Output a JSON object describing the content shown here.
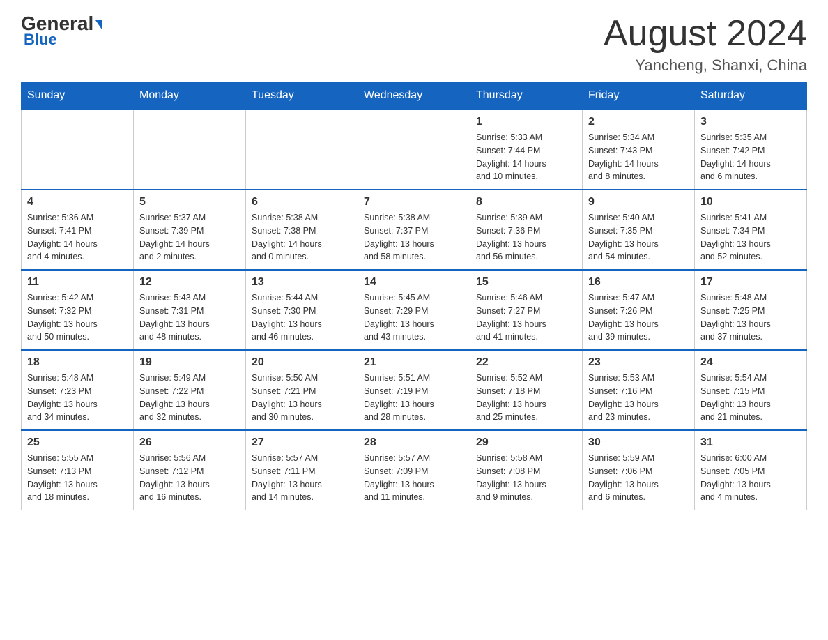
{
  "header": {
    "logo_general": "General",
    "logo_blue": "Blue",
    "month_title": "August 2024",
    "location": "Yancheng, Shanxi, China"
  },
  "weekdays": [
    "Sunday",
    "Monday",
    "Tuesday",
    "Wednesday",
    "Thursday",
    "Friday",
    "Saturday"
  ],
  "weeks": [
    [
      {
        "day": "",
        "info": ""
      },
      {
        "day": "",
        "info": ""
      },
      {
        "day": "",
        "info": ""
      },
      {
        "day": "",
        "info": ""
      },
      {
        "day": "1",
        "info": "Sunrise: 5:33 AM\nSunset: 7:44 PM\nDaylight: 14 hours\nand 10 minutes."
      },
      {
        "day": "2",
        "info": "Sunrise: 5:34 AM\nSunset: 7:43 PM\nDaylight: 14 hours\nand 8 minutes."
      },
      {
        "day": "3",
        "info": "Sunrise: 5:35 AM\nSunset: 7:42 PM\nDaylight: 14 hours\nand 6 minutes."
      }
    ],
    [
      {
        "day": "4",
        "info": "Sunrise: 5:36 AM\nSunset: 7:41 PM\nDaylight: 14 hours\nand 4 minutes."
      },
      {
        "day": "5",
        "info": "Sunrise: 5:37 AM\nSunset: 7:39 PM\nDaylight: 14 hours\nand 2 minutes."
      },
      {
        "day": "6",
        "info": "Sunrise: 5:38 AM\nSunset: 7:38 PM\nDaylight: 14 hours\nand 0 minutes."
      },
      {
        "day": "7",
        "info": "Sunrise: 5:38 AM\nSunset: 7:37 PM\nDaylight: 13 hours\nand 58 minutes."
      },
      {
        "day": "8",
        "info": "Sunrise: 5:39 AM\nSunset: 7:36 PM\nDaylight: 13 hours\nand 56 minutes."
      },
      {
        "day": "9",
        "info": "Sunrise: 5:40 AM\nSunset: 7:35 PM\nDaylight: 13 hours\nand 54 minutes."
      },
      {
        "day": "10",
        "info": "Sunrise: 5:41 AM\nSunset: 7:34 PM\nDaylight: 13 hours\nand 52 minutes."
      }
    ],
    [
      {
        "day": "11",
        "info": "Sunrise: 5:42 AM\nSunset: 7:32 PM\nDaylight: 13 hours\nand 50 minutes."
      },
      {
        "day": "12",
        "info": "Sunrise: 5:43 AM\nSunset: 7:31 PM\nDaylight: 13 hours\nand 48 minutes."
      },
      {
        "day": "13",
        "info": "Sunrise: 5:44 AM\nSunset: 7:30 PM\nDaylight: 13 hours\nand 46 minutes."
      },
      {
        "day": "14",
        "info": "Sunrise: 5:45 AM\nSunset: 7:29 PM\nDaylight: 13 hours\nand 43 minutes."
      },
      {
        "day": "15",
        "info": "Sunrise: 5:46 AM\nSunset: 7:27 PM\nDaylight: 13 hours\nand 41 minutes."
      },
      {
        "day": "16",
        "info": "Sunrise: 5:47 AM\nSunset: 7:26 PM\nDaylight: 13 hours\nand 39 minutes."
      },
      {
        "day": "17",
        "info": "Sunrise: 5:48 AM\nSunset: 7:25 PM\nDaylight: 13 hours\nand 37 minutes."
      }
    ],
    [
      {
        "day": "18",
        "info": "Sunrise: 5:48 AM\nSunset: 7:23 PM\nDaylight: 13 hours\nand 34 minutes."
      },
      {
        "day": "19",
        "info": "Sunrise: 5:49 AM\nSunset: 7:22 PM\nDaylight: 13 hours\nand 32 minutes."
      },
      {
        "day": "20",
        "info": "Sunrise: 5:50 AM\nSunset: 7:21 PM\nDaylight: 13 hours\nand 30 minutes."
      },
      {
        "day": "21",
        "info": "Sunrise: 5:51 AM\nSunset: 7:19 PM\nDaylight: 13 hours\nand 28 minutes."
      },
      {
        "day": "22",
        "info": "Sunrise: 5:52 AM\nSunset: 7:18 PM\nDaylight: 13 hours\nand 25 minutes."
      },
      {
        "day": "23",
        "info": "Sunrise: 5:53 AM\nSunset: 7:16 PM\nDaylight: 13 hours\nand 23 minutes."
      },
      {
        "day": "24",
        "info": "Sunrise: 5:54 AM\nSunset: 7:15 PM\nDaylight: 13 hours\nand 21 minutes."
      }
    ],
    [
      {
        "day": "25",
        "info": "Sunrise: 5:55 AM\nSunset: 7:13 PM\nDaylight: 13 hours\nand 18 minutes."
      },
      {
        "day": "26",
        "info": "Sunrise: 5:56 AM\nSunset: 7:12 PM\nDaylight: 13 hours\nand 16 minutes."
      },
      {
        "day": "27",
        "info": "Sunrise: 5:57 AM\nSunset: 7:11 PM\nDaylight: 13 hours\nand 14 minutes."
      },
      {
        "day": "28",
        "info": "Sunrise: 5:57 AM\nSunset: 7:09 PM\nDaylight: 13 hours\nand 11 minutes."
      },
      {
        "day": "29",
        "info": "Sunrise: 5:58 AM\nSunset: 7:08 PM\nDaylight: 13 hours\nand 9 minutes."
      },
      {
        "day": "30",
        "info": "Sunrise: 5:59 AM\nSunset: 7:06 PM\nDaylight: 13 hours\nand 6 minutes."
      },
      {
        "day": "31",
        "info": "Sunrise: 6:00 AM\nSunset: 7:05 PM\nDaylight: 13 hours\nand 4 minutes."
      }
    ]
  ]
}
